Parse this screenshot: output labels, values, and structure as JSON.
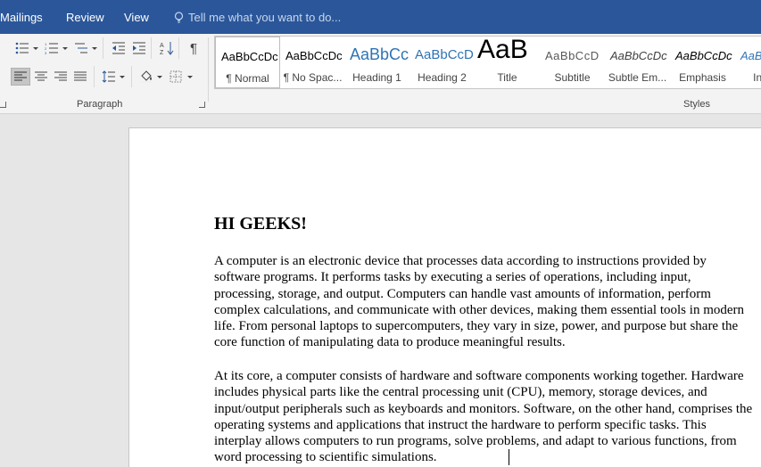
{
  "menu": {
    "tabs": [
      "Mailings",
      "Review",
      "View"
    ],
    "tell_me": "Tell me what you want to do..."
  },
  "ribbon": {
    "paragraph_group_label": "Paragraph",
    "styles_group_label": "Styles",
    "styles": [
      {
        "preview": "AaBbCcDc",
        "name": "¶ Normal"
      },
      {
        "preview": "AaBbCcDc",
        "name": "¶ No Spac..."
      },
      {
        "preview": "AaBbCc",
        "name": "Heading 1"
      },
      {
        "preview": "AaBbCcD",
        "name": "Heading 2"
      },
      {
        "preview": "AaB",
        "name": "Title"
      },
      {
        "preview": "AaBbCcD",
        "name": "Subtitle"
      },
      {
        "preview": "AaBbCcDc",
        "name": "Subtle Em..."
      },
      {
        "preview": "AaBbCcDc",
        "name": "Emphasis"
      },
      {
        "preview": "AaBb",
        "name": "Intens"
      }
    ],
    "colors": {
      "ribbon_blue": "#2b579a",
      "heading_blue": "#2e74b5"
    }
  },
  "document": {
    "title": "HI GEEKS!",
    "paragraphs": [
      "A computer is an electronic device that processes data according to instructions provided by software programs. It performs tasks by executing a series of operations, including input, processing, storage, and output. Computers can handle vast amounts of information, perform complex calculations, and communicate with other devices, making them essential tools in modern life. From personal laptops to supercomputers, they vary in size, power, and purpose but share the core function of manipulating data to produce meaningful results.",
      "At its core, a computer consists of hardware and software components working together. Hardware includes physical parts like the central processing unit (CPU), memory, storage devices, and input/output peripherals such as keyboards and monitors. Software, on the other hand, comprises the operating systems and applications that instruct the hardware to perform specific tasks. This interplay allows computers to run programs, solve problems, and adapt to various functions, from word processing to scientific simulations."
    ]
  }
}
